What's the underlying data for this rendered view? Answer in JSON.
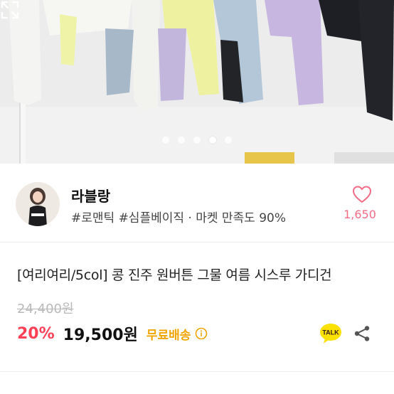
{
  "gallery": {
    "dots": [
      false,
      false,
      false,
      true,
      false
    ],
    "expand_icon": "expand-icon"
  },
  "seller": {
    "name": "라블랑",
    "tags": "#로맨틱 #심플베이직 · 마켓 만족도 90%",
    "likes": "1,650",
    "like_icon": "heart-icon"
  },
  "product": {
    "title": "[여리여리/5col] 콩 진주 원버튼 그물 여름 시스루 가디건",
    "original_price": "24,400원",
    "discount": "20%",
    "price": "19,500원",
    "shipping": "무료배송",
    "talk_label": "TALK",
    "share_icon": "share-icon"
  },
  "colors": {
    "accent_pink": "#ff4057",
    "like_pink": "#f36b86",
    "shipping_yellow": "#f0a500",
    "talk_yellow": "#fae100"
  }
}
